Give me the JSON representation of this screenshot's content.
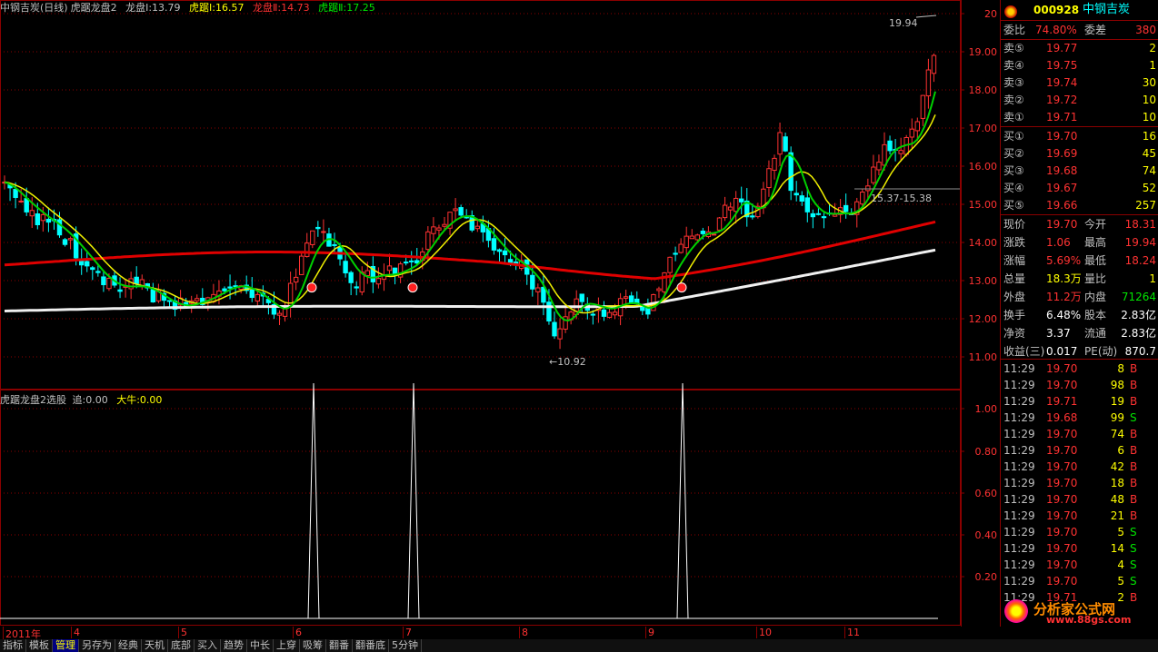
{
  "main_header": {
    "stock": "中钢吉炭(日线)",
    "indicator": "虎踞龙盘2",
    "items": [
      {
        "label": "龙盘Ⅰ:",
        "value": "13.79",
        "color": "#c0c0c0"
      },
      {
        "label": "虎踞Ⅰ:",
        "value": "16.57",
        "color": "#ffff00"
      },
      {
        "label": "龙盘Ⅱ:",
        "value": "14.73",
        "color": "#ff3232"
      },
      {
        "label": "虎踞Ⅱ:",
        "value": "17.25",
        "color": "#00e600"
      }
    ]
  },
  "sub_header": {
    "indicator": "虎踞龙盘2选股",
    "items": [
      {
        "label": "追:",
        "value": "0.00",
        "color": "#c0c0c0"
      },
      {
        "label": "大牛:",
        "value": "0.00",
        "color": "#ffff00"
      }
    ]
  },
  "annotations": {
    "high_label": "19.94",
    "low_label": "←10.92",
    "range_label": "15.37-15.38"
  },
  "price_axis": [
    "20",
    "19.00",
    "18.00",
    "17.00",
    "16.00",
    "15.00",
    "14.00",
    "13.00",
    "12.00",
    "11.00"
  ],
  "sub_axis": [
    "1.00",
    "0.80",
    "0.60",
    "0.40",
    "0.20"
  ],
  "time_axis": [
    "2011年",
    "4",
    "5",
    "6",
    "7",
    "8",
    "9",
    "10",
    "11"
  ],
  "quote": {
    "code": "000928",
    "name": "中钢吉炭",
    "weibi_label": "委比",
    "weibi": "74.80%",
    "weicha_label": "委差",
    "weicha": "380",
    "asks": [
      {
        "label": "卖⑤",
        "price": "19.77",
        "vol": "2"
      },
      {
        "label": "卖④",
        "price": "19.75",
        "vol": "1"
      },
      {
        "label": "卖③",
        "price": "19.74",
        "vol": "30"
      },
      {
        "label": "卖②",
        "price": "19.72",
        "vol": "10"
      },
      {
        "label": "卖①",
        "price": "19.71",
        "vol": "10"
      }
    ],
    "bids": [
      {
        "label": "买①",
        "price": "19.70",
        "vol": "16"
      },
      {
        "label": "买②",
        "price": "19.69",
        "vol": "45"
      },
      {
        "label": "买③",
        "price": "19.68",
        "vol": "74"
      },
      {
        "label": "买④",
        "price": "19.67",
        "vol": "52"
      },
      {
        "label": "买⑤",
        "price": "19.66",
        "vol": "257"
      }
    ],
    "stats": [
      {
        "l1": "现价",
        "v1": "19.70",
        "c1": "#ff3232",
        "l2": "今开",
        "v2": "18.31",
        "c2": "#ff3232"
      },
      {
        "l1": "涨跌",
        "v1": "1.06",
        "c1": "#ff3232",
        "l2": "最高",
        "v2": "19.94",
        "c2": "#ff3232"
      },
      {
        "l1": "涨幅",
        "v1": "5.69%",
        "c1": "#ff3232",
        "l2": "最低",
        "v2": "18.24",
        "c2": "#ff3232"
      },
      {
        "l1": "总量",
        "v1": "18.3万",
        "c1": "#ffff00",
        "l2": "量比",
        "v2": "1",
        "c2": "#ffff00"
      },
      {
        "l1": "外盘",
        "v1": "11.2万",
        "c1": "#ff3232",
        "l2": "内盘",
        "v2": "71264",
        "c2": "#00e600"
      },
      {
        "l1": "换手",
        "v1": "6.48%",
        "c1": "#ffffff",
        "l2": "股本",
        "v2": "2.83亿",
        "c2": "#ffffff"
      },
      {
        "l1": "净资",
        "v1": "3.37",
        "c1": "#ffffff",
        "l2": "流通",
        "v2": "2.83亿",
        "c2": "#ffffff"
      },
      {
        "l1": "收益(三)",
        "v1": "0.017",
        "c1": "#ffffff",
        "l2": "PE(动)",
        "v2": "870.7",
        "c2": "#ffffff"
      }
    ],
    "ticks": [
      {
        "t": "11:29",
        "p": "19.70",
        "v": "8",
        "s": "B"
      },
      {
        "t": "11:29",
        "p": "19.70",
        "v": "98",
        "s": "B"
      },
      {
        "t": "11:29",
        "p": "19.71",
        "v": "19",
        "s": "B"
      },
      {
        "t": "11:29",
        "p": "19.68",
        "v": "99",
        "s": "S"
      },
      {
        "t": "11:29",
        "p": "19.70",
        "v": "74",
        "s": "B"
      },
      {
        "t": "11:29",
        "p": "19.70",
        "v": "6",
        "s": "B"
      },
      {
        "t": "11:29",
        "p": "19.70",
        "v": "42",
        "s": "B"
      },
      {
        "t": "11:29",
        "p": "19.70",
        "v": "18",
        "s": "B"
      },
      {
        "t": "11:29",
        "p": "19.70",
        "v": "48",
        "s": "B"
      },
      {
        "t": "11:29",
        "p": "19.70",
        "v": "21",
        "s": "B"
      },
      {
        "t": "11:29",
        "p": "19.70",
        "v": "5",
        "s": "S"
      },
      {
        "t": "11:29",
        "p": "19.70",
        "v": "14",
        "s": "S"
      },
      {
        "t": "11:29",
        "p": "19.70",
        "v": "4",
        "s": "S"
      },
      {
        "t": "11:29",
        "p": "19.70",
        "v": "5",
        "s": "S"
      },
      {
        "t": "11:29",
        "p": "19.71",
        "v": "2",
        "s": "B"
      }
    ]
  },
  "watermark": {
    "line1": "分析家公式网",
    "line2": "www.88gs.com"
  },
  "tabs": [
    "指标",
    "模板",
    "管理",
    "另存为",
    "经典",
    "天机",
    "底部",
    "买入",
    "趋势",
    "中长",
    "上穿",
    "吸筹",
    "翻番",
    "翻番底",
    "5分钟"
  ],
  "active_tab": 2,
  "colors": {
    "up": "#ff3232",
    "down": "#00ffff",
    "ma_red": "#e00000",
    "ma_white": "#f0f0f0",
    "ma_green": "#00d000",
    "ma_yellow": "#f0f000",
    "grid": "#8b0000"
  }
}
